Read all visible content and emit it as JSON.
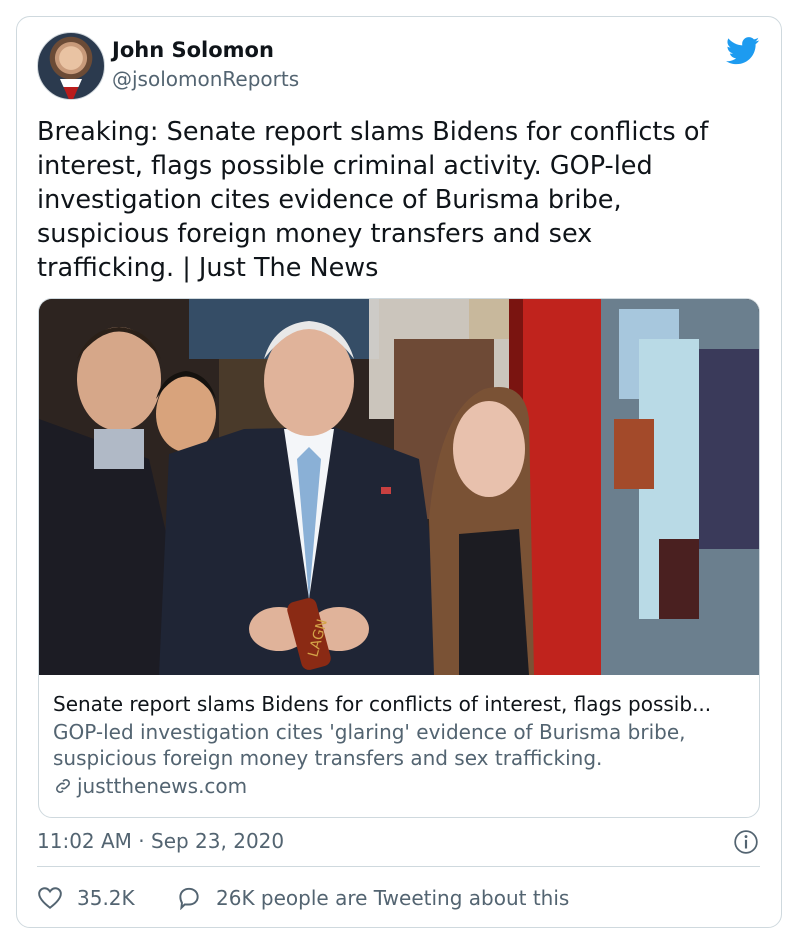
{
  "author": {
    "display_name": "John Solomon",
    "handle": "@jsolomonReports"
  },
  "tweet": {
    "text": "Breaking: Senate report slams Bidens for conflicts of\ninterest, flags possible criminal activity. GOP-led\ninvestigation cites evidence of Burisma bribe,\nsuspicious foreign money transfers and sex\ntrafficking. | Just The News"
  },
  "link_card": {
    "title": "Senate report slams Bidens for conflicts of interest, flags possib...",
    "description": "GOP-led investigation cites 'glaring' evidence of Burisma bribe, suspicious foreign money transfers and sex trafficking.",
    "domain": "justthenews.com",
    "candy_wrapper_text": "LAGN"
  },
  "meta": {
    "timestamp": "11:02 AM · Sep 23, 2020"
  },
  "actions": {
    "likes": "35.2K",
    "tweeting_about": "26K people are Tweeting about this"
  },
  "colors": {
    "twitter_blue": "#1d9bf0",
    "text_primary": "#0f1419",
    "text_secondary": "#536471",
    "border": "#cfd9de"
  }
}
